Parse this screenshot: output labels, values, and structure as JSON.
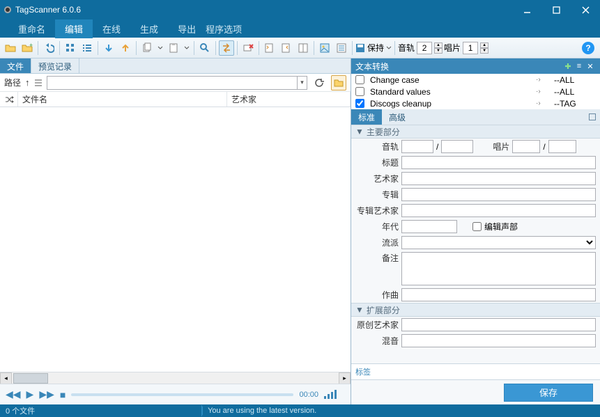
{
  "window": {
    "title": "TagScanner 6.0.6"
  },
  "menu": {
    "items": [
      "重命名",
      "编辑",
      "在线",
      "生成",
      "导出"
    ],
    "active_index": 1,
    "right": "程序选项"
  },
  "toolbar": {
    "keep_label": "保持",
    "track_label": "音轨",
    "track_value": "2",
    "disc_label": "唱片",
    "disc_value": "1"
  },
  "left_tabs": {
    "items": [
      "文件",
      "预览记录"
    ],
    "active_index": 0
  },
  "path": {
    "label": "路径",
    "value": ""
  },
  "columns": {
    "filename": "文件名",
    "artist": "艺术家"
  },
  "player": {
    "time": "00:00"
  },
  "text_transform": {
    "title": "文本转换",
    "scripts": [
      {
        "name": "Change case",
        "target": "--ALL",
        "checked": false
      },
      {
        "name": "Standard values",
        "target": "--ALL",
        "checked": false
      },
      {
        "name": "Discogs cleanup",
        "target": "--TAG",
        "checked": true
      }
    ]
  },
  "editor_tabs": {
    "items": [
      "标准",
      "高级"
    ],
    "active_index": 0
  },
  "sections": {
    "main": "主要部分",
    "ext": "扩展部分"
  },
  "fields": {
    "track": "音轨",
    "disc": "唱片",
    "title": "标题",
    "artist": "艺术家",
    "album": "专辑",
    "album_artist": "专辑艺术家",
    "year": "年代",
    "compilation": "编辑声部",
    "genre": "流派",
    "comment": "备注",
    "composer": "作曲",
    "orig_artist": "原创艺术家",
    "remix": "混音"
  },
  "tag_label": "标签",
  "save_btn": "保存",
  "status": {
    "files": "0 个文件",
    "version": "You are using the latest version."
  }
}
